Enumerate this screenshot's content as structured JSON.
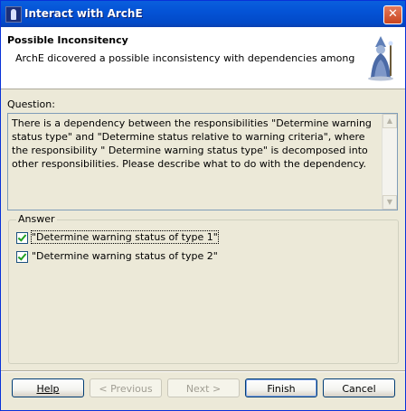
{
  "window": {
    "title": "Interact with ArchE"
  },
  "header": {
    "title": "Possible Inconsitency",
    "description": "ArchE dicovered a possible inconsistency with dependencies among"
  },
  "question": {
    "label": "Question:",
    "text": "There is a dependency between the responsibilities \"Determine warning status type\" and \"Determine status relative to warning criteria\", where the responsibility \" Determine warning status type\" is decomposed into other responsibilities. Please describe what to do with the dependency."
  },
  "answer": {
    "legend": "Answer",
    "options": [
      {
        "label": "\"Determine warning status of type 1\"",
        "checked": true
      },
      {
        "label": "\"Determine warning status of type 2\"",
        "checked": true
      }
    ]
  },
  "buttons": {
    "help": "Help",
    "previous": "< Previous",
    "next": "Next >",
    "finish": "Finish",
    "cancel": "Cancel"
  }
}
